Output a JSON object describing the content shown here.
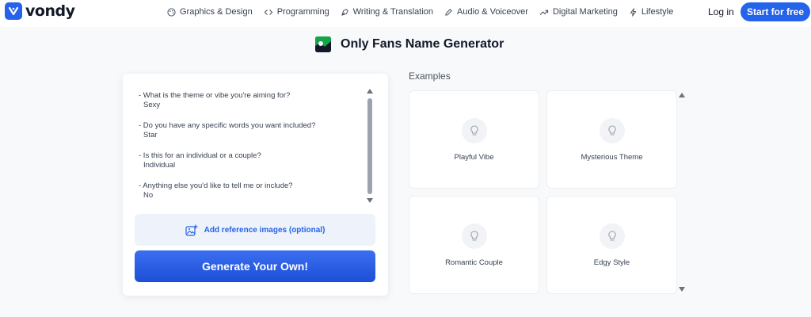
{
  "brand": {
    "name": "vondy",
    "accent": "#2563eb"
  },
  "nav": {
    "items": [
      {
        "label": "Graphics & Design",
        "icon": "palette-icon"
      },
      {
        "label": "Programming",
        "icon": "code-icon"
      },
      {
        "label": "Writing & Translation",
        "icon": "pen-nib-icon"
      },
      {
        "label": "Audio & Voiceover",
        "icon": "pencil-icon"
      },
      {
        "label": "Digital Marketing",
        "icon": "trend-icon"
      },
      {
        "label": "Lifestyle",
        "icon": "bolt-icon"
      }
    ],
    "login": "Log in",
    "cta": "Start for free"
  },
  "page": {
    "title": "Only Fans Name Generator"
  },
  "form": {
    "qa": [
      {
        "question": "- What is the theme or vibe you're aiming for?",
        "answer": "Sexy"
      },
      {
        "question": "- Do you have any specific words you want included?",
        "answer": "Star"
      },
      {
        "question": "- Is this for an individual or a couple?",
        "answer": "Individual"
      },
      {
        "question": "- Anything else you'd like to tell me or include?",
        "answer": "No"
      }
    ],
    "reference_button": "Add reference images (optional)",
    "generate_button": "Generate Your Own!"
  },
  "examples": {
    "label": "Examples",
    "items": [
      {
        "label": "Playful Vibe",
        "icon": "lightbulb-icon"
      },
      {
        "label": "Mysterious Theme",
        "icon": "lightbulb-icon"
      },
      {
        "label": "Romantic Couple",
        "icon": "lightbulb-icon"
      },
      {
        "label": "Edgy Style",
        "icon": "lightbulb-icon"
      }
    ]
  }
}
